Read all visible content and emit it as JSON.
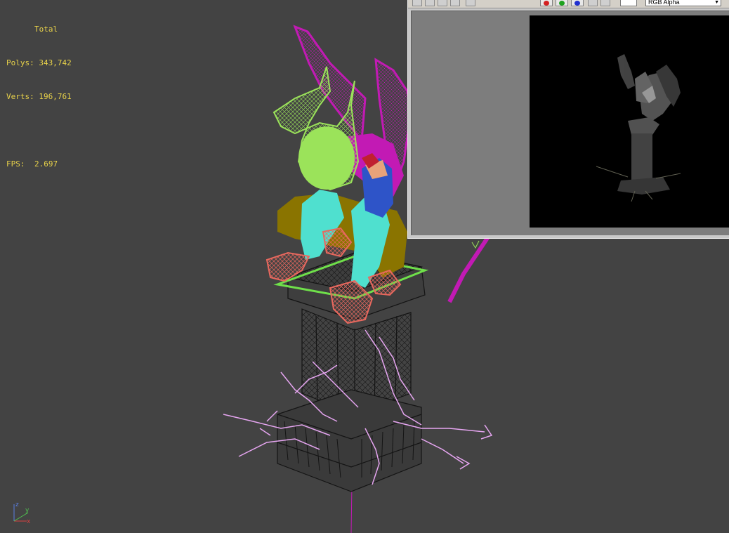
{
  "stats": {
    "header": "Total",
    "polys_label": "Polys:",
    "polys_value": "343,742",
    "verts_label": "Verts:",
    "verts_value": "196,761",
    "fps_label": "FPS:",
    "fps_value": "2.697"
  },
  "axis": {
    "x": "x",
    "y": "y",
    "z": "z"
  },
  "render_window": {
    "channel_select": "RGB Alpha",
    "colors": {
      "red": "#d42020",
      "green": "#1fa21f",
      "blue": "#2030d0"
    }
  },
  "colors": {
    "viewport_bg": "#434343",
    "stats_text": "#e8d24a",
    "wire_magenta": "#c21ab4",
    "wire_lime": "#9be35a",
    "wire_cyan": "#4fe0cf",
    "wire_salmon": "#e8685e",
    "wire_olive": "#8a7400",
    "wire_pink": "#e7a6f2",
    "wire_black": "#141414"
  }
}
